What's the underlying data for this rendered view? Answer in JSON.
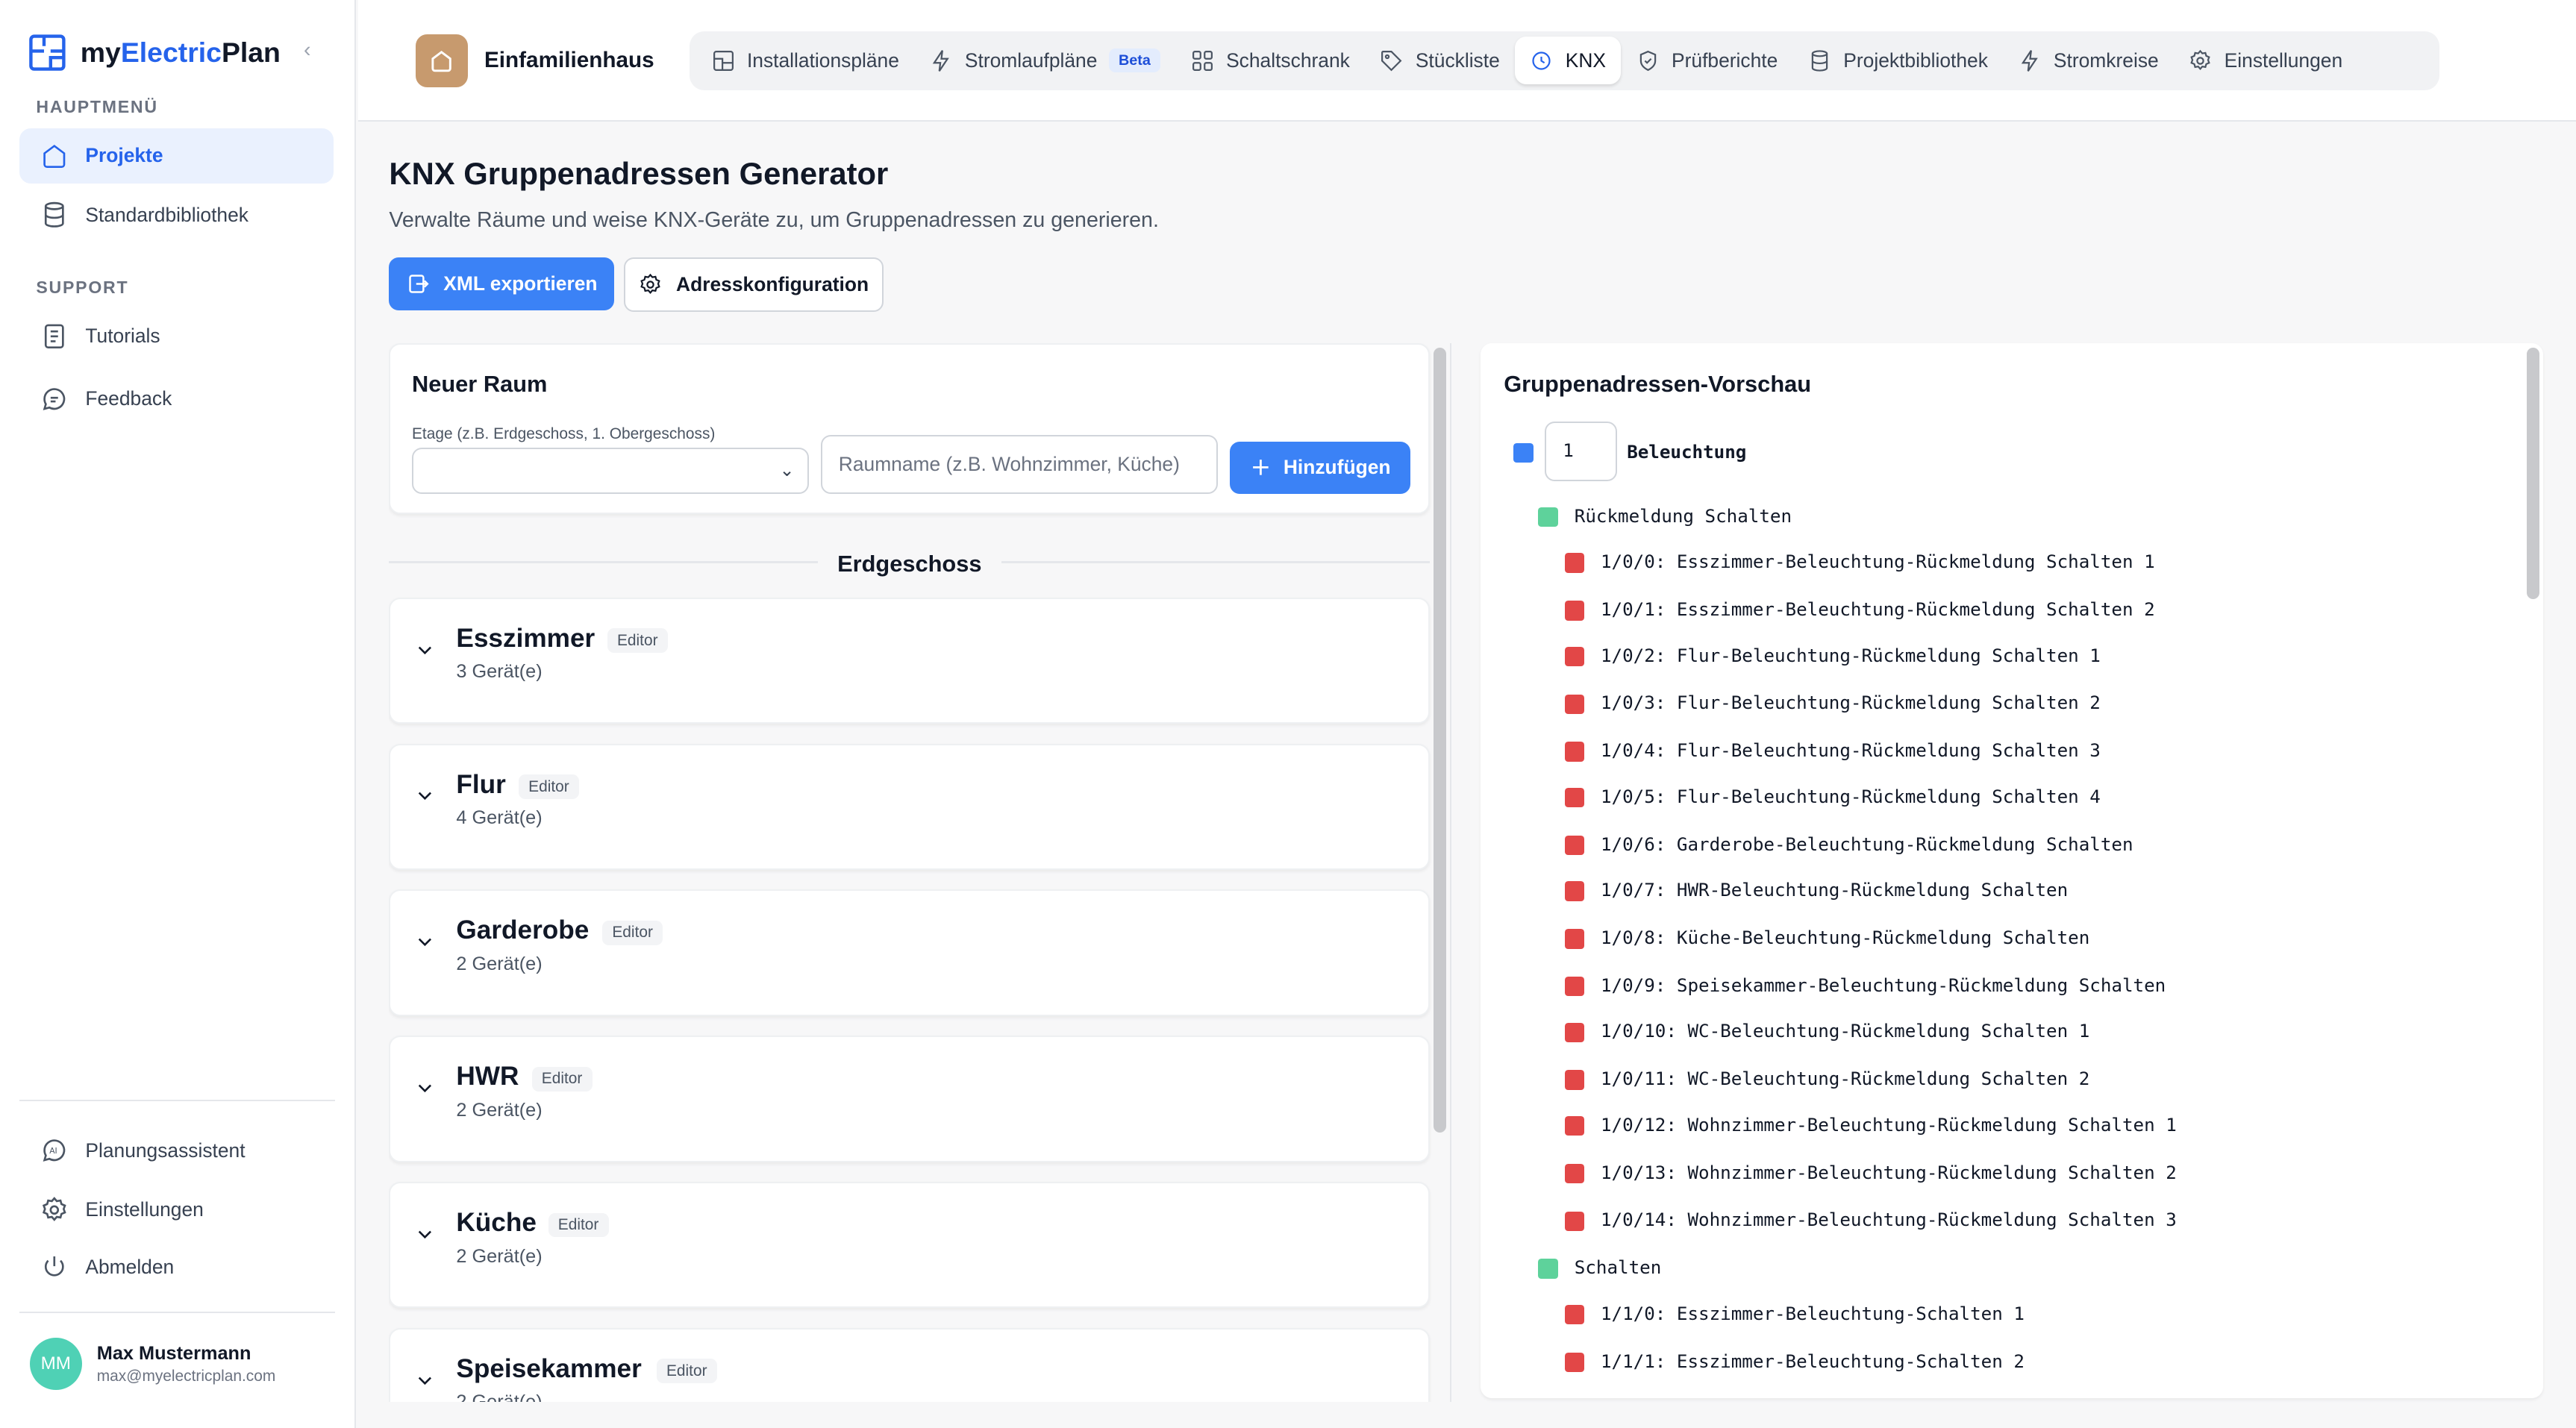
{
  "sidebar": {
    "logo_prefix": "my",
    "logo_accent": "Electric",
    "logo_suffix": "Plan",
    "section_main": "HAUPTMENÜ",
    "section_support": "SUPPORT",
    "items": [
      {
        "label": "Projekte",
        "icon": "home-icon",
        "active": true
      },
      {
        "label": "Standardbibliothek",
        "icon": "database-icon",
        "active": false
      },
      {
        "label": "Tutorials",
        "icon": "document-icon",
        "active": false
      },
      {
        "label": "Feedback",
        "icon": "chat-icon",
        "active": false
      }
    ],
    "bottom_items": [
      {
        "label": "Planungsassistent",
        "icon": "ai-icon"
      },
      {
        "label": "Einstellungen",
        "icon": "gear-icon"
      },
      {
        "label": "Abmelden",
        "icon": "power-icon"
      }
    ],
    "user": {
      "initials": "MM",
      "name": "Max Mustermann",
      "email": "max@myelectricplan.com"
    }
  },
  "header": {
    "project_name": "Einfamilienhaus",
    "tabs": [
      {
        "label": "Installationspläne",
        "icon": "layout-icon"
      },
      {
        "label": "Stromlaufpläne",
        "icon": "bolt-icon",
        "badge": "Beta"
      },
      {
        "label": "Schaltschrank",
        "icon": "grid-icon"
      },
      {
        "label": "Stückliste",
        "icon": "tag-icon"
      },
      {
        "label": "KNX",
        "icon": "knx-icon",
        "active": true
      },
      {
        "label": "Prüfberichte",
        "icon": "check-shield-icon"
      },
      {
        "label": "Projektbibliothek",
        "icon": "database-icon"
      },
      {
        "label": "Stromkreise",
        "icon": "bolt-icon"
      },
      {
        "label": "Einstellungen",
        "icon": "gear-icon"
      }
    ]
  },
  "main": {
    "title": "KNX Gruppenadressen Generator",
    "subtitle": "Verwalte Räume und weise KNX-Geräte zu, um Gruppenadressen zu generieren.",
    "export_button": "XML exportieren",
    "config_button": "Adresskonfiguration",
    "new_room": {
      "title": "Neuer Raum",
      "floor_label": "Etage (z.B. Erdgeschoss, 1. Obergeschoss)",
      "floor_value": "",
      "room_placeholder": "Raumname (z.B. Wohnzimmer, Küche)",
      "add_button": "Hinzufügen"
    },
    "floor": "Erdgeschoss",
    "rooms": [
      {
        "name": "Esszimmer",
        "badge": "Editor",
        "count": "3 Gerät(e)"
      },
      {
        "name": "Flur",
        "badge": "Editor",
        "count": "4 Gerät(e)"
      },
      {
        "name": "Garderobe",
        "badge": "Editor",
        "count": "2 Gerät(e)"
      },
      {
        "name": "HWR",
        "badge": "Editor",
        "count": "2 Gerät(e)"
      },
      {
        "name": "Küche",
        "badge": "Editor",
        "count": "2 Gerät(e)"
      },
      {
        "name": "Speisekammer",
        "badge": "Editor",
        "count": "2 Gerät(e)"
      }
    ]
  },
  "preview": {
    "title": "Gruppenadressen-Vorschau",
    "main_group": {
      "number": "1",
      "name": "Beleuchtung"
    },
    "middle_groups": [
      {
        "name": "Rückmeldung Schalten",
        "addresses": [
          "1/0/0: Esszimmer-Beleuchtung-Rückmeldung Schalten 1",
          "1/0/1: Esszimmer-Beleuchtung-Rückmeldung Schalten 2",
          "1/0/2: Flur-Beleuchtung-Rückmeldung Schalten 1",
          "1/0/3: Flur-Beleuchtung-Rückmeldung Schalten 2",
          "1/0/4: Flur-Beleuchtung-Rückmeldung Schalten 3",
          "1/0/5: Flur-Beleuchtung-Rückmeldung Schalten 4",
          "1/0/6: Garderobe-Beleuchtung-Rückmeldung Schalten",
          "1/0/7: HWR-Beleuchtung-Rückmeldung Schalten",
          "1/0/8: Küche-Beleuchtung-Rückmeldung Schalten",
          "1/0/9: Speisekammer-Beleuchtung-Rückmeldung Schalten",
          "1/0/10: WC-Beleuchtung-Rückmeldung Schalten 1",
          "1/0/11: WC-Beleuchtung-Rückmeldung Schalten 2",
          "1/0/12: Wohnzimmer-Beleuchtung-Rückmeldung Schalten 1",
          "1/0/13: Wohnzimmer-Beleuchtung-Rückmeldung Schalten 2",
          "1/0/14: Wohnzimmer-Beleuchtung-Rückmeldung Schalten 3"
        ]
      },
      {
        "name": "Schalten",
        "addresses": [
          "1/1/0: Esszimmer-Beleuchtung-Schalten 1",
          "1/1/1: Esszimmer-Beleuchtung-Schalten 2"
        ]
      }
    ]
  },
  "colors": {
    "accent": "#3b82f6",
    "main_group": "#3b82f6",
    "middle_group": "#5ed29b",
    "address": "#e24747"
  }
}
